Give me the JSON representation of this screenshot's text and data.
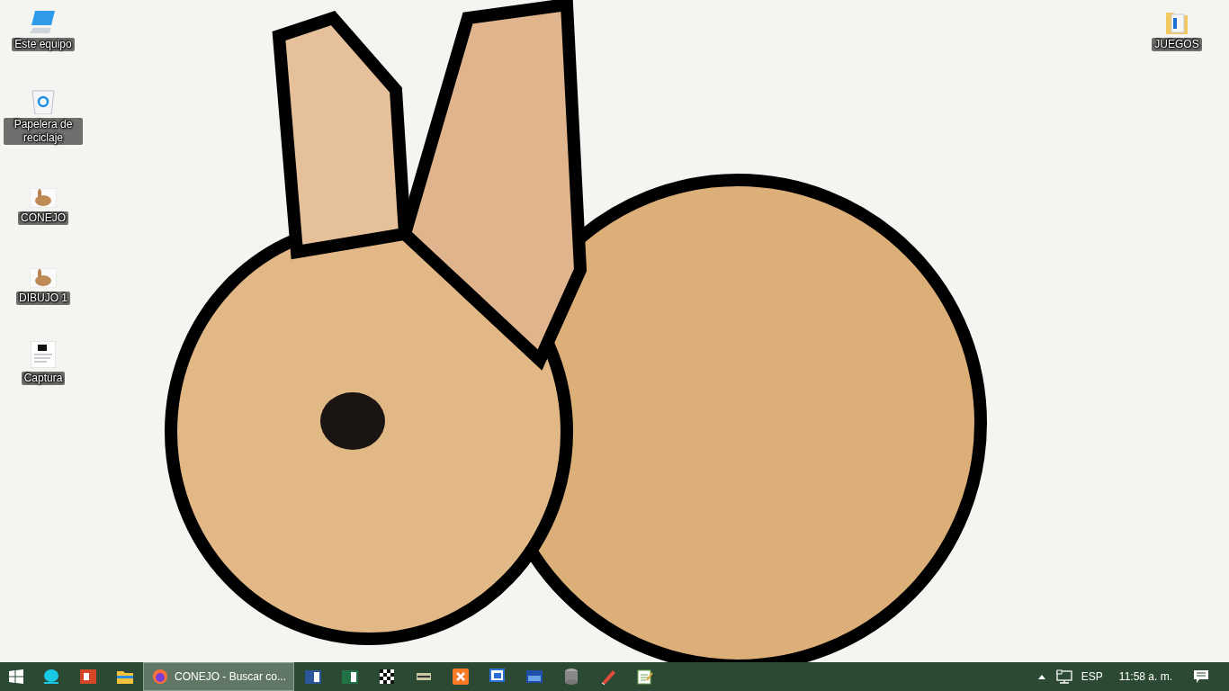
{
  "desktop": {
    "left_icons": [
      {
        "label": "Este equipo",
        "kind": "computer"
      },
      {
        "label": "Papelera de reciclaje",
        "kind": "recycle-bin"
      },
      {
        "label": "CONEJO",
        "kind": "image"
      },
      {
        "label": "DIBUJO 1",
        "kind": "image"
      },
      {
        "label": "Captura",
        "kind": "screenshot"
      }
    ],
    "right_icons": [
      {
        "label": "JUEGOS",
        "kind": "folder"
      }
    ]
  },
  "taskbar": {
    "apps": [
      {
        "kind": "chat",
        "active": false
      },
      {
        "kind": "slides",
        "active": false
      },
      {
        "kind": "explorer",
        "active": false
      },
      {
        "kind": "browser",
        "active": true,
        "label": "CONEJO - Buscar co..."
      },
      {
        "kind": "word",
        "active": false
      },
      {
        "kind": "sheet",
        "active": false
      },
      {
        "kind": "checker",
        "active": false
      },
      {
        "kind": "tool",
        "active": false
      },
      {
        "kind": "server",
        "active": false
      },
      {
        "kind": "vb",
        "active": false
      },
      {
        "kind": "ide",
        "active": false
      },
      {
        "kind": "database",
        "active": false
      },
      {
        "kind": "pen",
        "active": false
      },
      {
        "kind": "notepad",
        "active": false
      }
    ],
    "language": "ESP",
    "time": "11:58 a. m."
  }
}
